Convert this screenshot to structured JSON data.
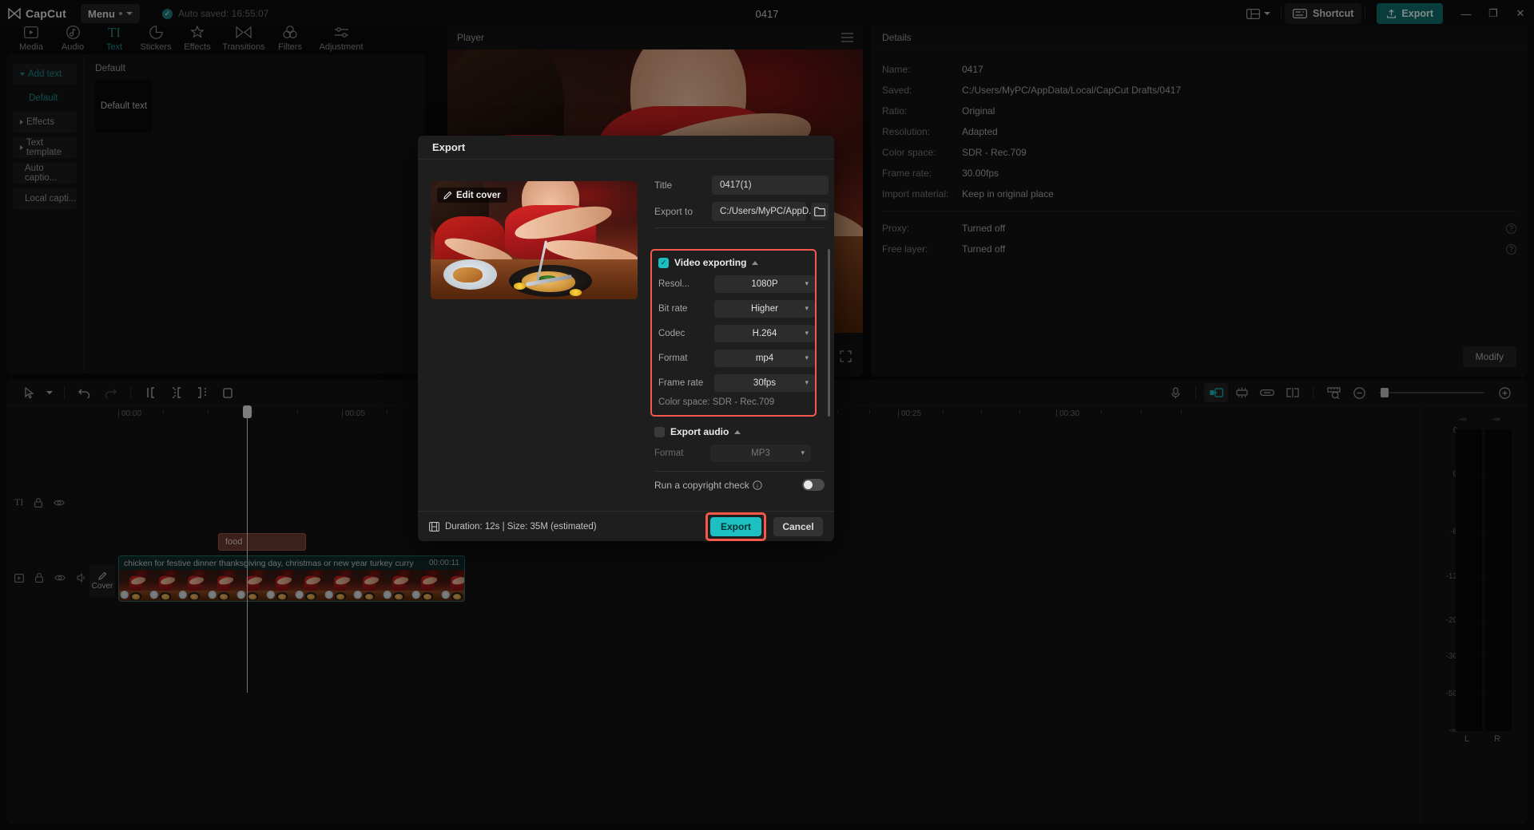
{
  "titlebar": {
    "app_name": "CapCut",
    "menu_label": "Menu",
    "autosave_text": "Auto saved: 16:55:07",
    "doc_title": "0417",
    "layout_icon": "layout-icon",
    "shortcut_label": "Shortcut",
    "export_label": "Export",
    "minimize": "—",
    "maximize": "❐",
    "close": "✕"
  },
  "navtabs": [
    {
      "label": "Media",
      "icon": "media-icon",
      "active": false
    },
    {
      "label": "Audio",
      "icon": "audio-icon",
      "active": false
    },
    {
      "label": "Text",
      "icon": "text-icon",
      "active": true
    },
    {
      "label": "Stickers",
      "icon": "stickers-icon",
      "active": false
    },
    {
      "label": "Effects",
      "icon": "effects-icon",
      "active": false
    },
    {
      "label": "Transitions",
      "icon": "transitions-icon",
      "active": false
    },
    {
      "label": "Filters",
      "icon": "filters-icon",
      "active": false
    },
    {
      "label": "Adjustment",
      "icon": "adjustment-icon",
      "active": false
    }
  ],
  "leftnav": {
    "items": [
      {
        "label": "Add text",
        "accent": true,
        "arrow": "down"
      },
      {
        "label": "Effects",
        "accent": false,
        "arrow": "right"
      },
      {
        "label": "Text template",
        "accent": false,
        "arrow": "right"
      },
      {
        "label": "Auto captio...",
        "accent": false,
        "arrow": "none"
      },
      {
        "label": "Local capti...",
        "accent": false,
        "arrow": "none"
      }
    ],
    "sub_item": "Default"
  },
  "leftcontent": {
    "heading": "Default",
    "card_label": "Default text"
  },
  "player": {
    "title": "Player",
    "menu_icon": "hamburger-icon"
  },
  "details": {
    "title": "Details",
    "rows": [
      {
        "key": "Name:",
        "value": "0417",
        "help": false
      },
      {
        "key": "Saved:",
        "value": "C:/Users/MyPC/AppData/Local/CapCut Drafts/0417",
        "help": false
      },
      {
        "key": "Ratio:",
        "value": "Original",
        "help": false
      },
      {
        "key": "Resolution:",
        "value": "Adapted",
        "help": false
      },
      {
        "key": "Color space:",
        "value": "SDR - Rec.709",
        "help": false
      },
      {
        "key": "Frame rate:",
        "value": "30.00fps",
        "help": false
      },
      {
        "key": "Import material:",
        "value": "Keep in original place",
        "help": false
      }
    ],
    "rows2": [
      {
        "key": "Proxy:",
        "value": "Turned off",
        "help": true
      },
      {
        "key": "Free layer:",
        "value": "Turned off",
        "help": true
      }
    ],
    "modify_label": "Modify"
  },
  "timeline": {
    "tools": [
      {
        "name": "select-tool-icon",
        "state": "normal"
      },
      {
        "name": "tool-dropdown-icon",
        "state": "normal"
      },
      {
        "name": "undo-icon",
        "state": "normal"
      },
      {
        "name": "redo-icon",
        "state": "disabled"
      },
      {
        "name": "split-left-icon",
        "state": "normal"
      },
      {
        "name": "split-icon",
        "state": "normal"
      },
      {
        "name": "split-right-icon",
        "state": "normal"
      },
      {
        "name": "delete-icon",
        "state": "normal"
      }
    ],
    "right_tools": [
      {
        "name": "mic-record-icon",
        "state": "normal"
      },
      {
        "name": "magnet-snap-icon",
        "state": "active"
      },
      {
        "name": "auto-adjust-icon",
        "state": "normal"
      },
      {
        "name": "link-icon",
        "state": "normal"
      },
      {
        "name": "split-clip-icon",
        "state": "normal"
      },
      {
        "name": "ruler-zoom-icon",
        "state": "normal"
      },
      {
        "name": "zoom-out-icon",
        "state": "normal"
      },
      {
        "name": "zoom-in-icon",
        "state": "normal"
      }
    ],
    "ruler_labels": [
      "00:00",
      "00:05",
      "00:25",
      "00:30"
    ],
    "text_clip_label": "food",
    "cover_button_label": "Cover",
    "video_clip_label": "chicken for festive dinner thanksgiving day, christmas or new year turkey curry",
    "video_clip_duration": "00:00:11",
    "track_icons_text": [
      "text-track-icon",
      "lock-icon",
      "eye-icon"
    ],
    "track_icons_video": [
      "video-track-icon",
      "lock-icon",
      "eye-icon",
      "speaker-icon"
    ]
  },
  "meter": {
    "top_labels": [
      "-∞",
      "-∞"
    ],
    "scale": [
      "6",
      "0",
      "-6",
      "-12",
      "-20",
      "-30",
      "-50",
      "-∞"
    ],
    "channels": [
      "L",
      "R"
    ]
  },
  "dialog": {
    "title": "Export",
    "edit_cover_label": "Edit cover",
    "title_label": "Title",
    "title_value": "0417(1)",
    "export_to_label": "Export to",
    "export_to_value": "C:/Users/MyPC/AppD...",
    "folder_icon": "folder-icon",
    "video_group": {
      "title": "Video exporting",
      "checked": true,
      "fields": [
        {
          "label": "Resol...",
          "value": "1080P"
        },
        {
          "label": "Bit rate",
          "value": "Higher"
        },
        {
          "label": "Codec",
          "value": "H.264"
        },
        {
          "label": "Format",
          "value": "mp4"
        },
        {
          "label": "Frame rate",
          "value": "30fps"
        }
      ],
      "note": "Color space: SDR - Rec.709"
    },
    "audio_group": {
      "title": "Export audio",
      "checked": false,
      "fields": [
        {
          "label": "Format",
          "value": "MP3"
        }
      ]
    },
    "copyright_label": "Run a copyright check",
    "copyright_on": false,
    "footer_info": "Duration: 12s | Size: 35M (estimated)",
    "export_label": "Export",
    "cancel_label": "Cancel",
    "highlight_color": "#f4594c"
  },
  "colors": {
    "accent_teal": "#1dc0c0",
    "brand_teal": "#1e8b8a",
    "highlight_red": "#f4594c",
    "panel_bg": "#131313",
    "dialog_bg": "#1e1e1e"
  }
}
